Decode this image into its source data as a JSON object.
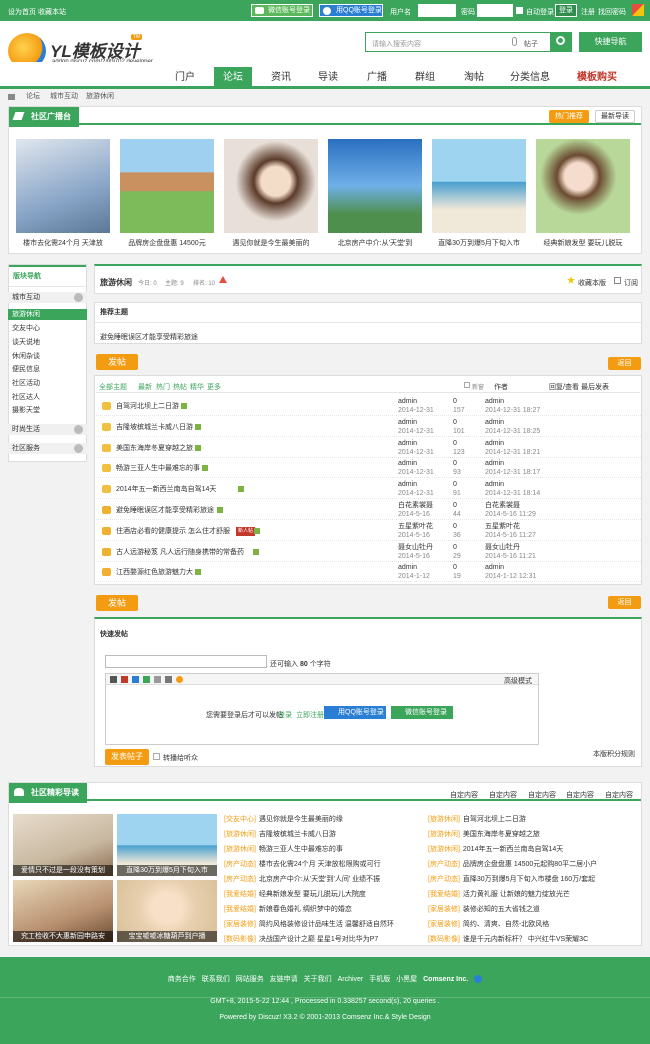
{
  "topbar": {
    "home": "设为首页",
    "fav": "收藏本站",
    "wechat": "微信账号登录",
    "qq": "用QQ账号登录",
    "user_label": "用户名",
    "pass_label": "密码",
    "auto": "自动登录",
    "login": "登录",
    "register": "注册",
    "forgot": "找回密码"
  },
  "header": {
    "logo": "YL模板设计",
    "logo_badge": "TM",
    "logo_sub": "addon.discuz.com/?@9702.developer",
    "search_placeholder": "请输入搜索内容",
    "search_type": "帖子",
    "quick_nav": "快捷导航"
  },
  "nav": [
    "门户",
    "论坛",
    "资讯",
    "导读",
    "广播",
    "群组",
    "淘帖",
    "分类信息",
    "模板购买"
  ],
  "breadcrumb": [
    "论坛",
    "城市互动",
    "旅游休闲"
  ],
  "broadcast": {
    "title": "社区广播台",
    "hot": "热门推荐",
    "latest": "最新导读",
    "items": [
      {
        "caption": "楼市去化需24个月 天津放",
        "color": "#8aa6c8"
      },
      {
        "caption": "品牌房企盘盘惠 14500元",
        "color": "#7dbb5a"
      },
      {
        "caption": "遇见你就是今生最美丽的",
        "color": "#d9c2b0"
      },
      {
        "caption": "北京房产中介:从'天堂'到",
        "color": "#4a8fd0"
      },
      {
        "caption": "直降30万到爆5月下旬入市",
        "color": "#8ec9e8"
      },
      {
        "caption": "经典新娘发型 要玩儿脱玩",
        "color": "#a8c98a"
      }
    ]
  },
  "sidebar": {
    "title": "版块导航",
    "items": [
      "城市互动",
      "旅游休闲",
      "交友中心",
      "谈天说地",
      "休闲杂谈",
      "便民信息",
      "社区活动",
      "社区达人",
      "摄影天堂",
      "时尚生活",
      "社区服务"
    ]
  },
  "forum": {
    "name": "旅游休闲",
    "today": "今日: 0",
    "topics": "主题: 9",
    "rank": "排名: 10",
    "fav": "收藏本版",
    "sub": "订阅",
    "recommend": "推荐主题",
    "recommend_text": "避免睡眠误区才能享受精彩旅途",
    "post": "发帖",
    "back": "返回",
    "filters": [
      "全部主题",
      "最新",
      "热门",
      "热帖",
      "精华",
      "更多"
    ],
    "new": "新窗",
    "col_author": "作者",
    "col_reply": "回复/查看",
    "col_last": "最后发表",
    "threads": [
      {
        "title": "自驾河北坝上二日游",
        "author": "admin",
        "date": "2014-12-31",
        "replies": "0",
        "views": "157",
        "last": "admin",
        "lastdate": "2014-12-31 18:27",
        "icon": "#f0c040",
        "tag": ""
      },
      {
        "title": "吉隆坡槟城兰卡威八日游",
        "author": "admin",
        "date": "2014-12-31",
        "replies": "0",
        "views": "101",
        "last": "admin",
        "lastdate": "2014-12-31 18:25",
        "icon": "#f0c040",
        "tag": ""
      },
      {
        "title": "美国东海岸冬夏穿越之旅",
        "author": "admin",
        "date": "2014-12-31",
        "replies": "0",
        "views": "123",
        "last": "admin",
        "lastdate": "2014-12-31 18:21",
        "icon": "#f0c040",
        "tag": ""
      },
      {
        "title": "畅游三亚人生中最难忘的事",
        "author": "admin",
        "date": "2014-12-31",
        "replies": "0",
        "views": "93",
        "last": "admin",
        "lastdate": "2014-12-31 18:17",
        "icon": "#f0c040",
        "tag": ""
      },
      {
        "title": "2014年五一新西兰南岛自驾14天",
        "author": "admin",
        "date": "2014-12-31",
        "replies": "0",
        "views": "91",
        "last": "admin",
        "lastdate": "2014-12-31 18:14",
        "icon": "#f0c040",
        "tag": ""
      },
      {
        "title": "避免睡眠误区才能享受精彩旅途",
        "author": "白花素裳聂",
        "date": "2014-5-16",
        "replies": "0",
        "views": "44",
        "last": "白花素裳聂",
        "lastdate": "2014-5-16 11:29",
        "icon": "#f0b030",
        "tag": ""
      },
      {
        "title": "住酒店必看的健康提示 怎么住才舒服",
        "author": "五星紫叶花",
        "date": "2014-5-16",
        "replies": "0",
        "views": "36",
        "last": "五星紫叶花",
        "lastdate": "2014-5-16 11:27",
        "icon": "#f0b030",
        "tag": "新人帖"
      },
      {
        "title": "古人远游秘笈 凡人远行随身携带的常备药",
        "author": "聂女山牡丹",
        "date": "2014-5-16",
        "replies": "0",
        "views": "29",
        "last": "聂女山牡丹",
        "lastdate": "2014-5-16 11:21",
        "icon": "#f0b030",
        "tag": ""
      },
      {
        "title": "江西婺源红色旅游魅力大",
        "author": "admin",
        "date": "2014-1-12",
        "replies": "0",
        "views": "19",
        "last": "admin",
        "lastdate": "2014-1-12 12:31",
        "icon": "#f0b030",
        "tag": ""
      }
    ]
  },
  "quick": {
    "title": "快速发帖",
    "limit_pre": "还可输入",
    "limit_num": "80",
    "limit_post": "个字符",
    "adv": "高级模式",
    "login_text": "您需要登录后才可以发帖",
    "login": "登录",
    "register": "立即注册",
    "qq": "用QQ账号登录",
    "wechat": "微信账号登录",
    "submit": "发表帖子",
    "notify": "转播给听众",
    "rules": "本版积分规则"
  },
  "featured": {
    "title": "社区精彩导读",
    "links": [
      "自定内容",
      "自定内容",
      "自定内容",
      "自定内容",
      "自定内容"
    ],
    "thumbs": [
      {
        "caption": "爱情只不过是一段没有策划",
        "color": "#c8b8a0"
      },
      {
        "caption": "直降30万到爆5月下旬入市",
        "color": "#7fb8e0"
      },
      {
        "caption": "究工检收不大惠新园申路安",
        "color": "#b89070"
      },
      {
        "caption": "宝宝嘘嘘冰糖葫芦到户播",
        "color": "#e8d0b0"
      }
    ],
    "left": [
      {
        "cat": "[交友中心]",
        "text": "遇见你就是今生最美丽的缘"
      },
      {
        "cat": "[旅游休闲]",
        "text": "吉隆坡槟城兰卡威八日游"
      },
      {
        "cat": "[旅游休闲]",
        "text": "畅游三亚人生中最难忘的事"
      },
      {
        "cat": "[房产动态]",
        "text": "楼市去化需24个月 天津放松限购或可行"
      },
      {
        "cat": "[房产动态]",
        "text": "北京房产中介:从'天堂'到'人间' 业绩不振"
      },
      {
        "cat": "[我爱结婚]",
        "text": "经典新娘发型 要玩儿脱玩儿大院度"
      },
      {
        "cat": "[我爱结婚]",
        "text": "新娘春色婚礼 绸织梦中的婚恋"
      },
      {
        "cat": "[家居装修]",
        "text": "简约风格装修设计品味生活 温馨舒适自然环"
      },
      {
        "cat": "[数码影像]",
        "text": "决战国产设计之巅 星星1号对比华为P7"
      }
    ],
    "right": [
      {
        "cat": "[旅游休闲]",
        "text": "自驾河北坝上二日游"
      },
      {
        "cat": "[旅游休闲]",
        "text": "美国东海岸冬夏穿越之旅"
      },
      {
        "cat": "[旅游休闲]",
        "text": "2014年五一新西兰南岛自驾14天"
      },
      {
        "cat": "[房产动态]",
        "text": "品牌房企盘盘惠 14500元起购80平二居小户"
      },
      {
        "cat": "[房产动态]",
        "text": "直降30万到爆5月下旬入市楼盘 160万/套起"
      },
      {
        "cat": "[我爱结婚]",
        "text": "活力黄礼服 让新娘的魅力绽放光芒"
      },
      {
        "cat": "[家居装修]",
        "text": "装修必知的五大省钱之道"
      },
      {
        "cat": "[家居装修]",
        "text": "简约、清爽、自然-北欧风格"
      },
      {
        "cat": "[数码影像]",
        "text": "谁是千元内新标杆？ 中兴红牛VS荣耀3C"
      }
    ]
  },
  "footer": {
    "links": [
      "商务合作",
      "联系我们",
      "网站服务",
      "友链申请",
      "关于我们",
      "Archiver",
      "手机版",
      "小黑屋",
      "Comsenz Inc."
    ],
    "time": "GMT+8, 2015-5-22 12:44 , Processed in 0.338257 second(s), 20 queries .",
    "powered": "Powered by Discuz! X3.2 © 2001-2013 Comsenz Inc.& Style Design"
  }
}
